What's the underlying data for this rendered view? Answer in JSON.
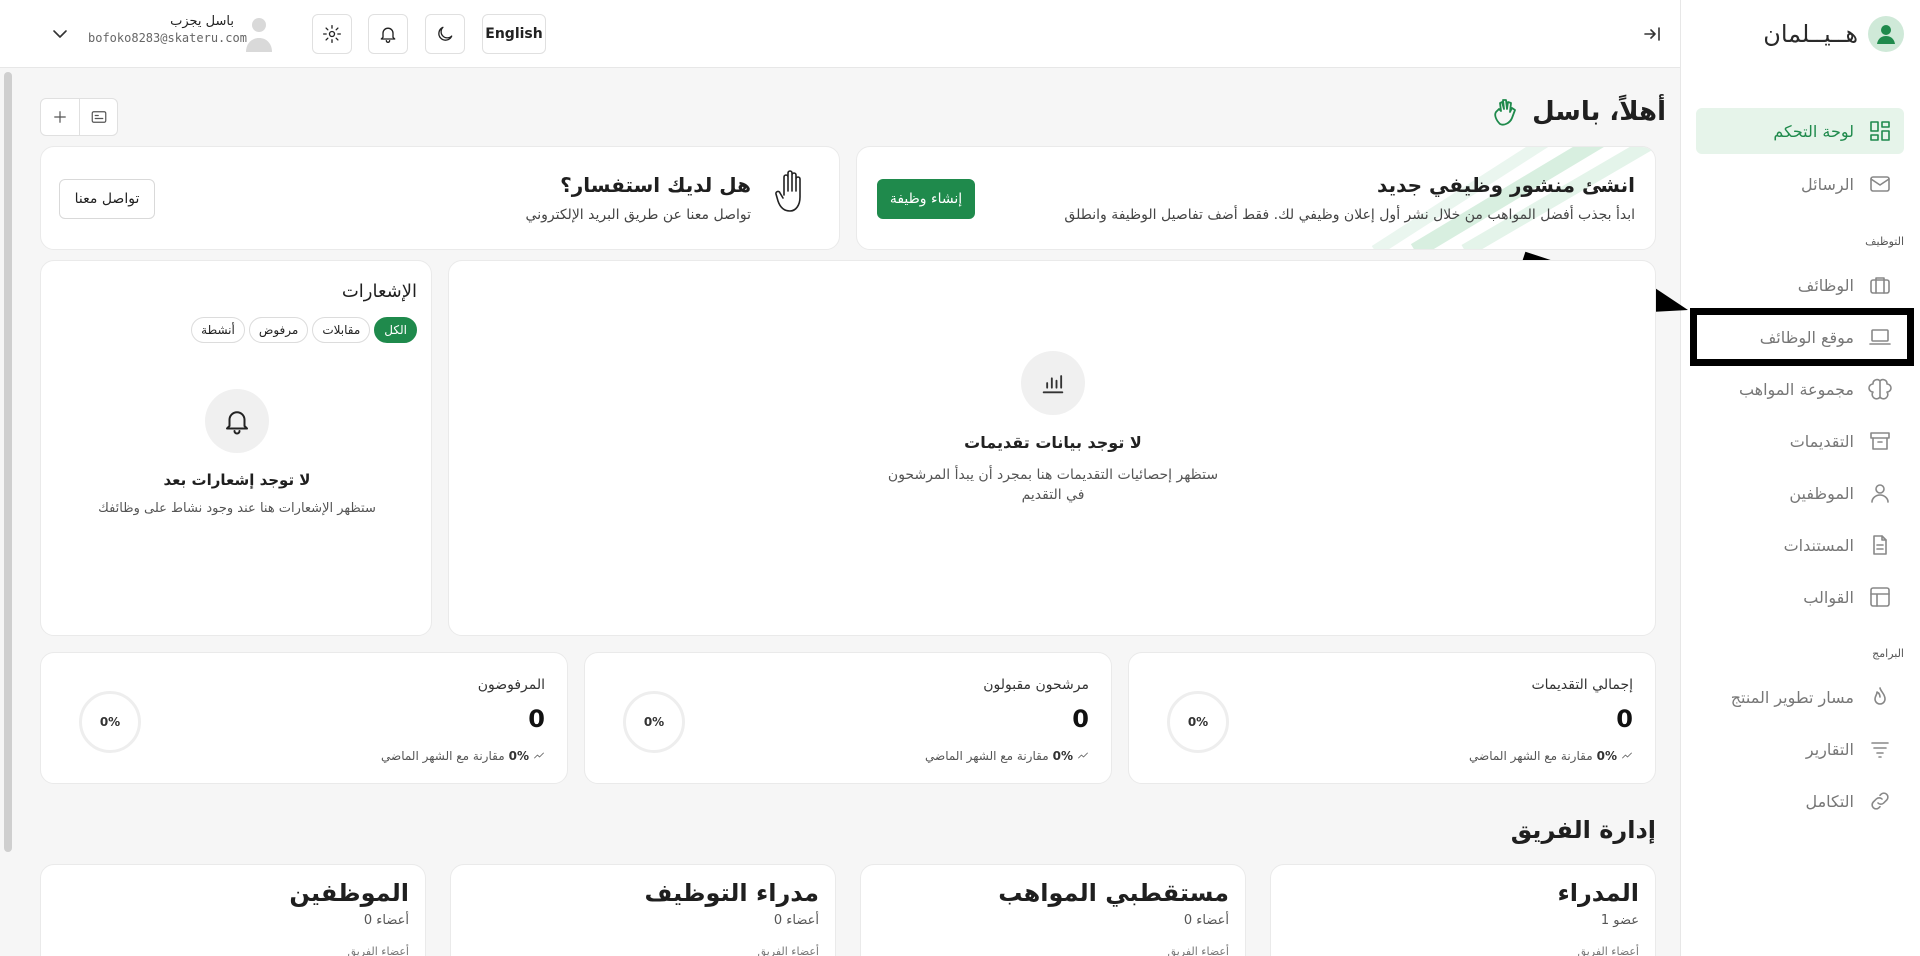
{
  "brand": {
    "name": "هــيــلمان"
  },
  "header": {
    "user_name": "باسل يجزب",
    "user_email": "bofoko8283@skateru.com",
    "language": "English"
  },
  "sidebar": {
    "sections": {
      "hiring": "التوظيف",
      "programs": "البرامج"
    },
    "items": [
      {
        "label": "لوحة التحكم",
        "icon": "grid-icon",
        "active": true
      },
      {
        "label": "الرسائل",
        "icon": "mail-icon"
      },
      {
        "label": "الوظائف",
        "icon": "briefcase-icon"
      },
      {
        "label": "موقع الوظائف",
        "icon": "laptop-icon"
      },
      {
        "label": "مجموعة المواهب",
        "icon": "brain-icon"
      },
      {
        "label": "التقديمات",
        "icon": "inbox-icon"
      },
      {
        "label": "الموظفين",
        "icon": "user-icon"
      },
      {
        "label": "المستندات",
        "icon": "document-icon"
      },
      {
        "label": "القوالب",
        "icon": "template-icon"
      },
      {
        "label": "مسار تطوير المنتج",
        "icon": "flame-icon"
      },
      {
        "label": "التقارير",
        "icon": "filter-icon"
      },
      {
        "label": "التكامل",
        "icon": "link-icon"
      }
    ]
  },
  "main": {
    "greeting": "أهلاً، باسل",
    "job_card": {
      "title": "انشئ منشور وظيفي جديد",
      "subtitle": "ابدأ بجذب أفضل المواهب من خلال نشر أول إعلان وظيفي لك. فقط أضف تفاصيل الوظيفة وانطلق",
      "button": "إنشاء وظيفة"
    },
    "inquiry_card": {
      "title": "هل لديك استفسار؟",
      "subtitle": "تواصل معنا عن طريق البريد الإلكتروني",
      "button": "تواصل معنا"
    },
    "applications": {
      "empty_title": "لا توجد بيانات تقديمات",
      "empty_sub": "ستظهر إحصائيات التقديمات هنا بمجرد أن يبدأ المرشحون في التقديم"
    },
    "notifications": {
      "title": "الإشعارات",
      "filters": [
        "الكل",
        "مقابلات",
        "مرفوض",
        "أنشطة"
      ],
      "empty_title": "لا توجد إشعارات بعد",
      "empty_sub": "ستظهر الإشعارات هنا عند وجود نشاط على وظائفك"
    },
    "stats": [
      {
        "title": "إجمالي التقديمات",
        "value": "0",
        "pct": "0%",
        "comparison": "مقارنة مع الشهر الماضي",
        "ring": "0%"
      },
      {
        "title": "مرشحون مقبولون",
        "value": "0",
        "pct": "0%",
        "comparison": "مقارنة مع الشهر الماضي",
        "ring": "0%"
      },
      {
        "title": "المرفوضون",
        "value": "0",
        "pct": "0%",
        "comparison": "مقارنة مع الشهر الماضي",
        "ring": "0%"
      }
    ],
    "team": {
      "title": "إدارة الفريق",
      "groups": [
        {
          "name": "المدراء",
          "count": "1 عضو",
          "sub": "أعضاء الفريق"
        },
        {
          "name": "مستقطبي المواهب",
          "count": "0 أعضاء",
          "sub": "أعضاء الفريق"
        },
        {
          "name": "مدراء التوظيف",
          "count": "0 أعضاء",
          "sub": "أعضاء الفريق"
        },
        {
          "name": "الموظفين",
          "count": "0 أعضاء",
          "sub": "أعضاء الفريق"
        }
      ]
    }
  },
  "colors": {
    "accent": "#1f8a4c",
    "accent_light": "#e6f4ea"
  }
}
